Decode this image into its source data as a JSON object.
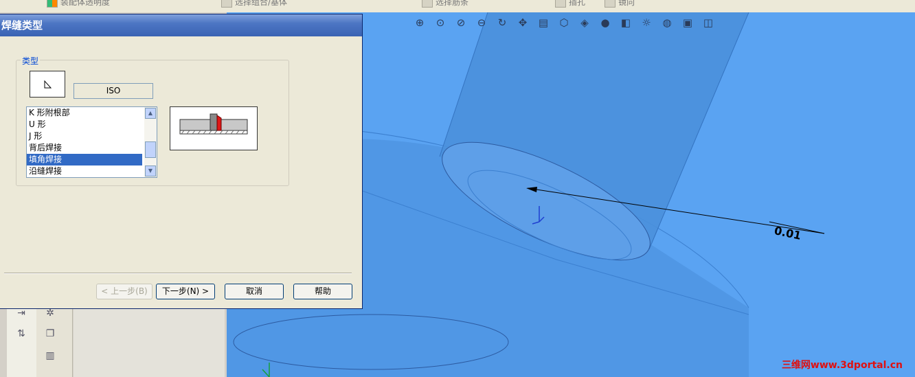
{
  "top_toolbar": {
    "items": [
      "装配体透明度",
      "选择组合/基体",
      "选择筋条",
      "插孔",
      "镜向"
    ]
  },
  "viewport": {
    "toolbar_icons": [
      "zoom-fit-icon",
      "zoom-area-icon",
      "zoom-in-out-icon",
      "zoom-select-icon",
      "rotate-icon",
      "pan-icon",
      "section-icon",
      "view-orient-icon",
      "display-style-icon",
      "hide-show-icon",
      "appearance-icon",
      "lights-icon",
      "scene-icon",
      "render-icon",
      "view-cube-icon"
    ],
    "annotation": "0.01"
  },
  "dialog": {
    "title": "焊缝类型",
    "group_label": "类型",
    "standard": "ISO",
    "weld_types": [
      "K 形附根部",
      "U 形",
      "J 形",
      "背后焊接",
      "填角焊接",
      "沿缝焊接"
    ],
    "selected_index": 4,
    "buttons": {
      "back": "< 上一步(B)",
      "next": "下一步(N) >",
      "cancel": "取消",
      "help": "帮助"
    }
  },
  "watermark": "三维网www.3dportal.cn",
  "colors": {
    "viewport_bg": "#5aa3f2",
    "title_bar": "#3a63b3",
    "selection": "#316ac5",
    "dialog_bg": "#ece9d8"
  }
}
